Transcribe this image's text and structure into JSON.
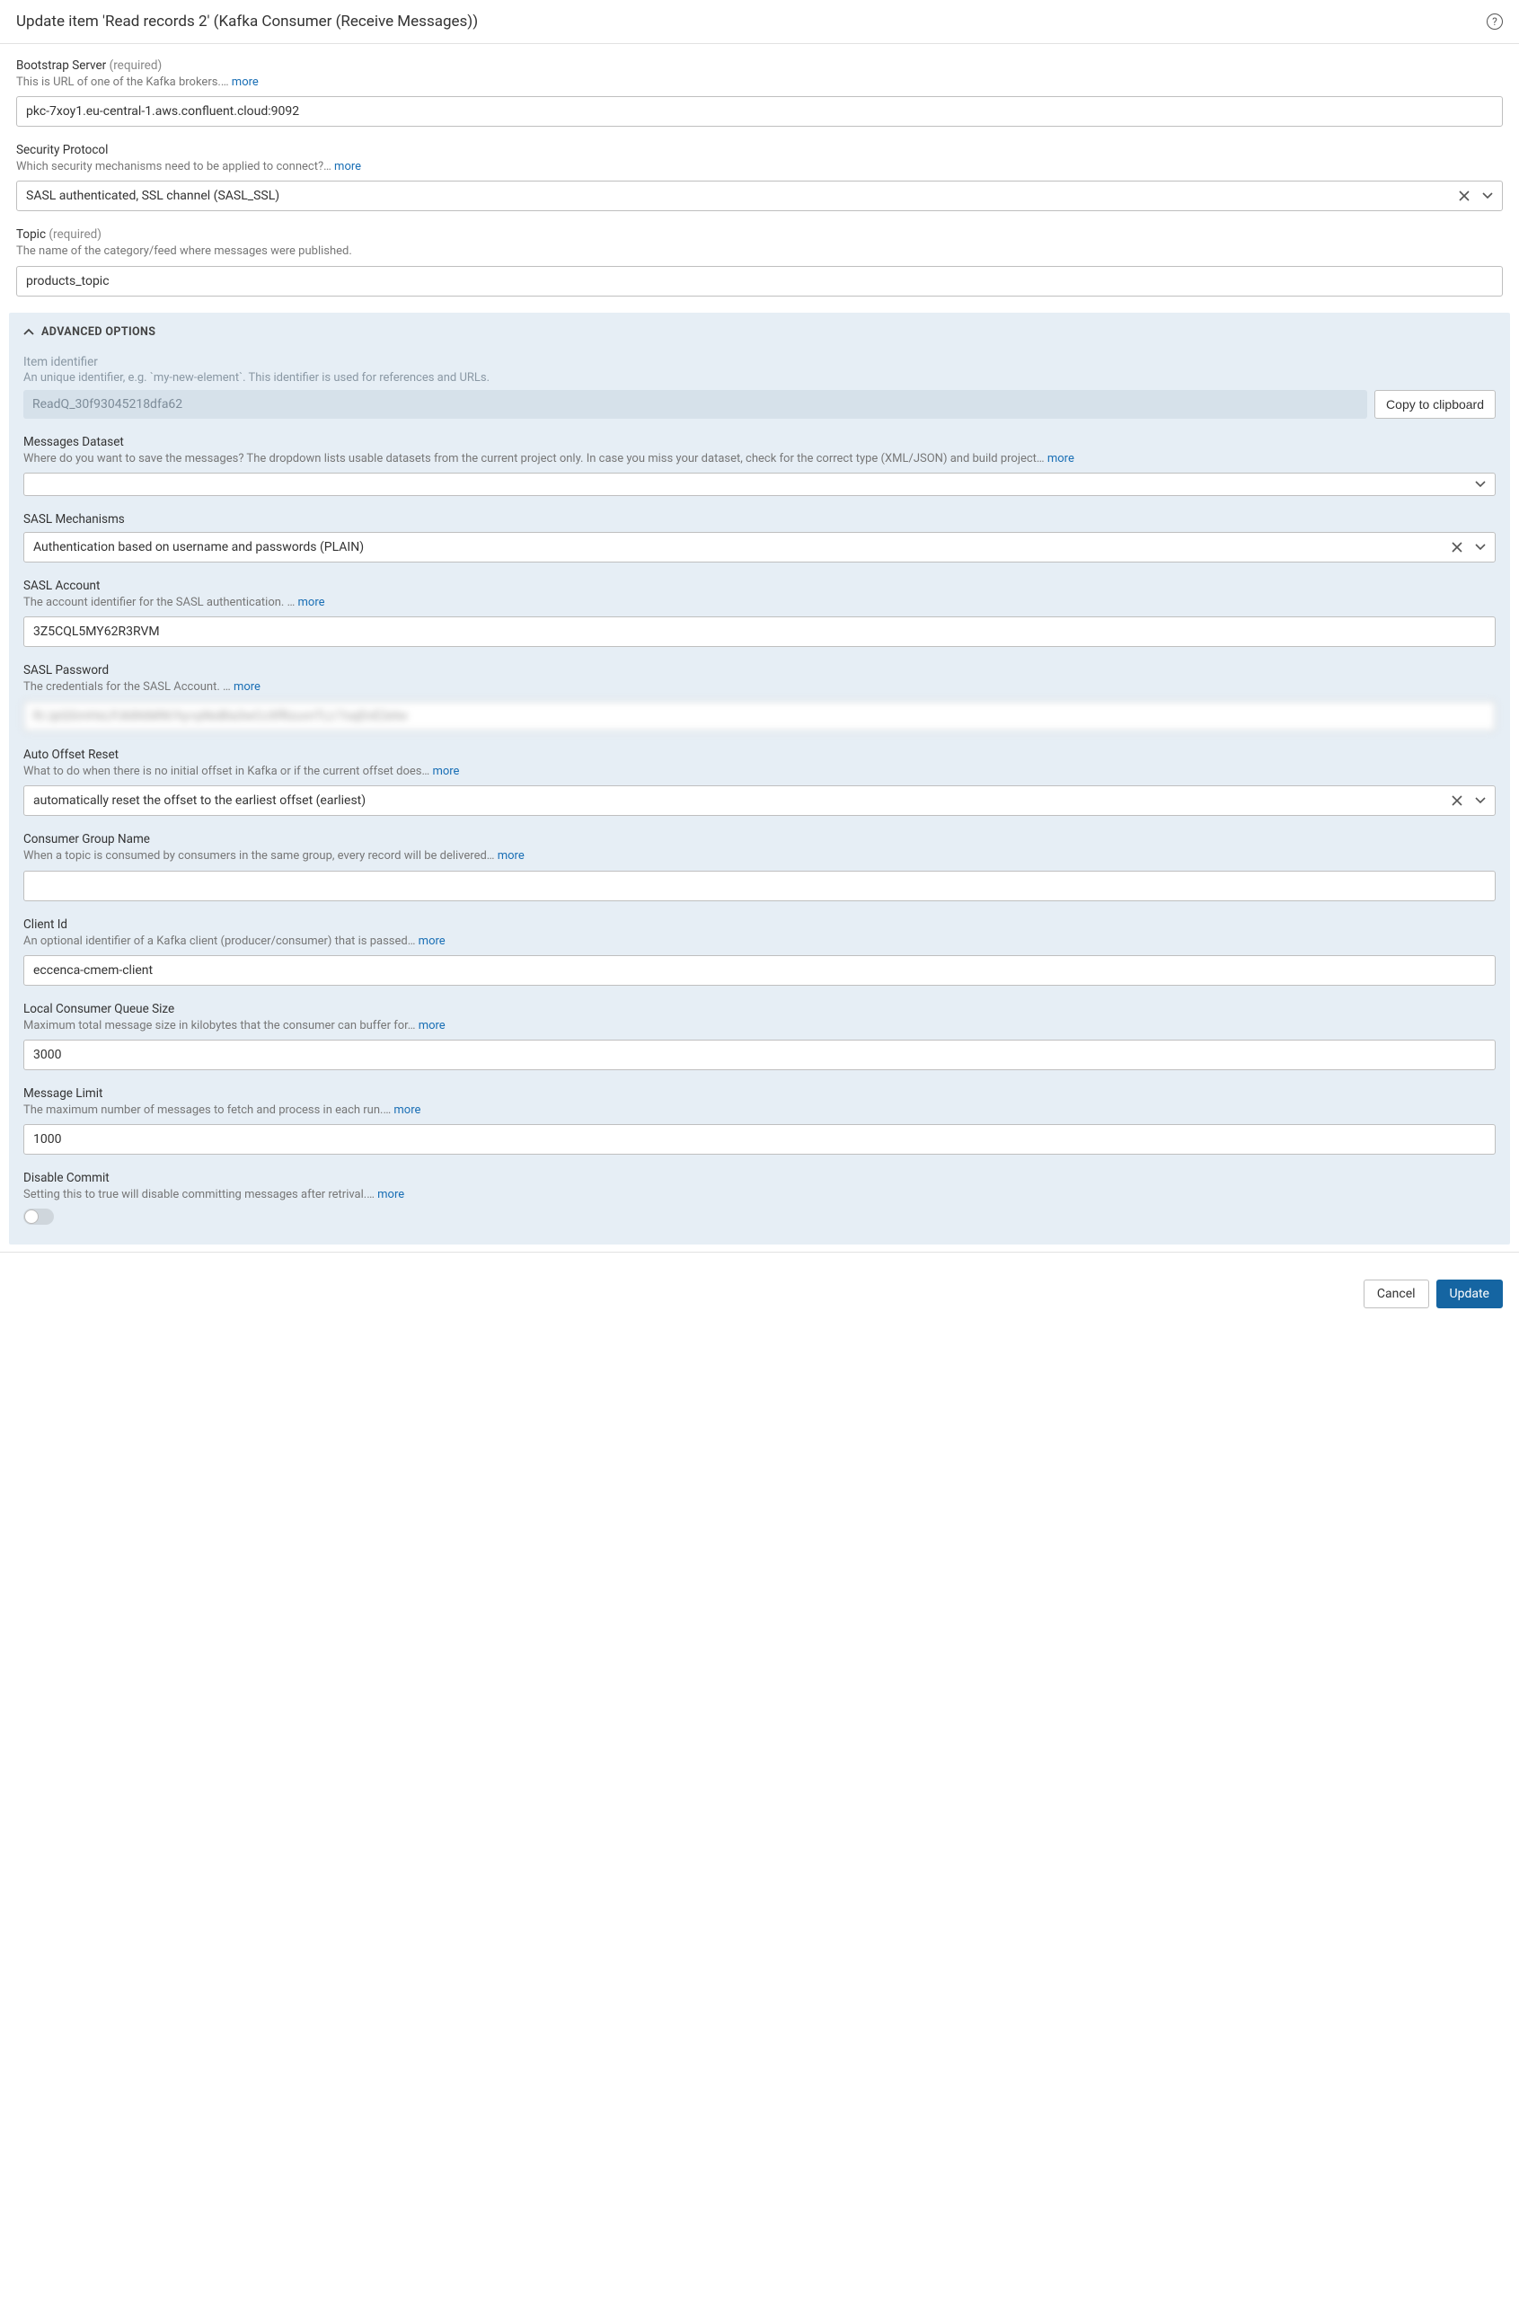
{
  "header": {
    "title": "Update item 'Read records 2' (Kafka Consumer (Receive Messages))"
  },
  "fields": {
    "bootstrap": {
      "label": "Bootstrap Server",
      "required": "(required)",
      "help": "This is URL of one of the Kafka brokers.…",
      "more": "more",
      "value": "pkc-7xoy1.eu-central-1.aws.confluent.cloud:9092"
    },
    "security": {
      "label": "Security Protocol",
      "help": "Which security mechanisms need to be applied to connect?…",
      "more": "more",
      "value": "SASL authenticated, SSL channel (SASL_SSL)"
    },
    "topic": {
      "label": "Topic",
      "required": "(required)",
      "help": "The name of the category/feed where messages were published.",
      "value": "products_topic"
    }
  },
  "advanced": {
    "header": "ADVANCED OPTIONS",
    "identifier": {
      "label": "Item identifier",
      "help": "An unique identifier, e.g. `my-new-element`. This identifier is used for references and URLs.",
      "value": "ReadQ_30f93045218dfa62",
      "copy": "Copy to clipboard"
    },
    "dataset": {
      "label": "Messages Dataset",
      "help": "Where do you want to save the messages? The dropdown lists usable datasets from the current project only. In case you miss your dataset, check for the correct type (XML/JSON) and build project…",
      "more": "more",
      "value": ""
    },
    "sasl_mech": {
      "label": "SASL Mechanisms",
      "value": "Authentication based on username and passwords (PLAIN)"
    },
    "sasl_account": {
      "label": "SASL Account",
      "help": "The account identifier for the SASL authentication. …",
      "more": "more",
      "value": "3Z5CQL5MY62R3RVM"
    },
    "sasl_password": {
      "label": "SASL Password",
      "help": "The credentials for the SASL Account. …",
      "more": "more",
      "value": "R/JpQGmHxLPJk8t6MW/hy+pNoBIa3wCcXfRzuvnTLi/7oqDvE2etw"
    },
    "auto_offset": {
      "label": "Auto Offset Reset",
      "help": "What to do when there is no initial offset in Kafka or if the current offset does…",
      "more": "more",
      "value": "automatically reset the offset to the earliest offset (earliest)"
    },
    "group": {
      "label": "Consumer Group Name",
      "help": "When a topic is consumed by consumers in the same group, every record will be delivered…",
      "more": "more",
      "value": ""
    },
    "client_id": {
      "label": "Client Id",
      "help": "An optional identifier of a Kafka client (producer/consumer) that is passed…",
      "more": "more",
      "value": "eccenca-cmem-client"
    },
    "queue": {
      "label": "Local Consumer Queue Size",
      "help": "Maximum total message size in kilobytes that the consumer can buffer for…",
      "more": "more",
      "value": "3000"
    },
    "limit": {
      "label": "Message Limit",
      "help": "The maximum number of messages to fetch and process in each run.…",
      "more": "more",
      "value": "1000"
    },
    "disable_commit": {
      "label": "Disable Commit",
      "help": "Setting this to true will disable committing messages after retrival.…",
      "more": "more"
    }
  },
  "footer": {
    "cancel": "Cancel",
    "update": "Update"
  }
}
